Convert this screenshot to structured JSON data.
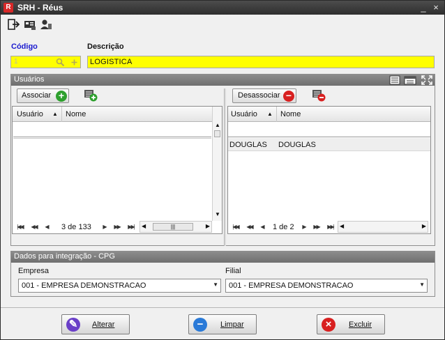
{
  "window": {
    "title": "SRH - Réus",
    "app_icon": "R",
    "minimize_glyph": "_",
    "close_glyph": "×"
  },
  "toolbar": {
    "icons": [
      "exit-icon",
      "id-card-icon",
      "user-badge-icon"
    ]
  },
  "form": {
    "codigo_label": "Código",
    "codigo_value": "1",
    "descricao_label": "Descrição",
    "descricao_value": "LOGISTICA"
  },
  "usuarios_panel": {
    "title": "Usuários",
    "left": {
      "button_label": "Associar",
      "columns": [
        "Usuário",
        "Nome"
      ],
      "rows": [],
      "pager_text": "3 de 133"
    },
    "right": {
      "button_label": "Desassociar",
      "columns": [
        "Usuário",
        "Nome"
      ],
      "rows": [
        {
          "usuario": "DOUGLAS",
          "nome": "DOUGLAS"
        }
      ],
      "pager_text": "1 de 2"
    }
  },
  "integracao_panel": {
    "title": "Dados para integração - CPG",
    "empresa_label": "Empresa",
    "empresa_value": "001 - EMPRESA DEMONSTRACAO",
    "filial_label": "Filial",
    "filial_value": "001 - EMPRESA DEMONSTRACAO"
  },
  "actions": {
    "alterar_label": "Alterar",
    "limpar_label": "Limpar",
    "excluir_label": "Excluir"
  },
  "colors": {
    "title_bar": "#3a3a3a",
    "required_field": "#ffff00",
    "codigo_label": "#1a1acf",
    "panel_header": "#7f7f7f",
    "add_green": "#2ea02e",
    "remove_red": "#d82020",
    "clear_blue": "#2a7ad8",
    "edit_purple": "#6a3fc8"
  }
}
